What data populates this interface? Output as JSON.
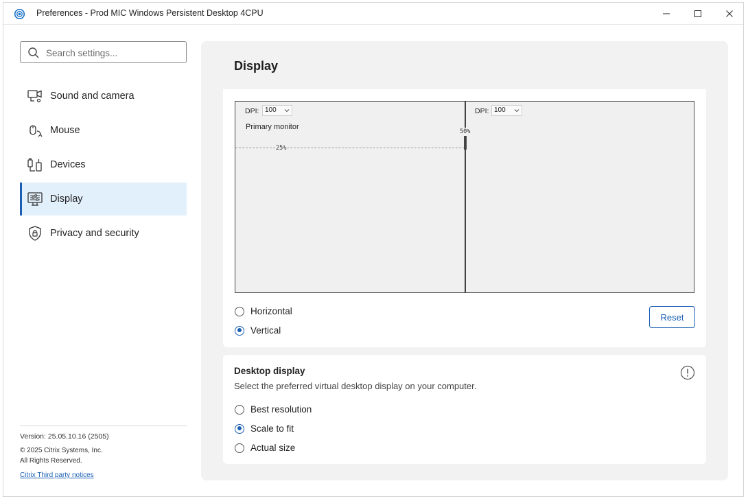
{
  "window": {
    "title": "Preferences - Prod MIC Windows Persistent Desktop 4CPU"
  },
  "sidebar": {
    "search_placeholder": "Search settings...",
    "items": [
      {
        "label": "Sound and camera",
        "icon": "camera-icon"
      },
      {
        "label": "Mouse",
        "icon": "mouse-icon"
      },
      {
        "label": "Devices",
        "icon": "devices-icon"
      },
      {
        "label": "Display",
        "icon": "display-icon",
        "active": true
      },
      {
        "label": "Privacy and security",
        "icon": "shield-lock-icon"
      }
    ],
    "version": "Version: 25.05.10.16 (2505)",
    "copyright": "© 2025 Citrix Systems, Inc.",
    "rights": "All Rights Reserved.",
    "notice_link": "Citrix Third party notices"
  },
  "main": {
    "title": "Display",
    "layout": {
      "monitor1": {
        "dpi_label": "DPI:",
        "dpi_value": "100",
        "name": "Primary monitor",
        "offset_label": "25%"
      },
      "monitor2": {
        "dpi_label": "DPI:",
        "dpi_value": "100",
        "offset_label": "50%"
      },
      "orientation_options": [
        {
          "label": "Horizontal",
          "selected": false
        },
        {
          "label": "Vertical",
          "selected": true
        }
      ],
      "reset_label": "Reset"
    },
    "desktop_display": {
      "title": "Desktop display",
      "description": "Select the preferred virtual desktop display on your computer.",
      "options": [
        {
          "label": "Best resolution",
          "selected": false
        },
        {
          "label": "Scale to fit",
          "selected": true
        },
        {
          "label": "Actual size",
          "selected": false
        }
      ]
    }
  },
  "colors": {
    "accent": "#1a5fb4",
    "active_nav_bg": "#e2f0fb",
    "panel_bg": "#f2f2f2"
  }
}
